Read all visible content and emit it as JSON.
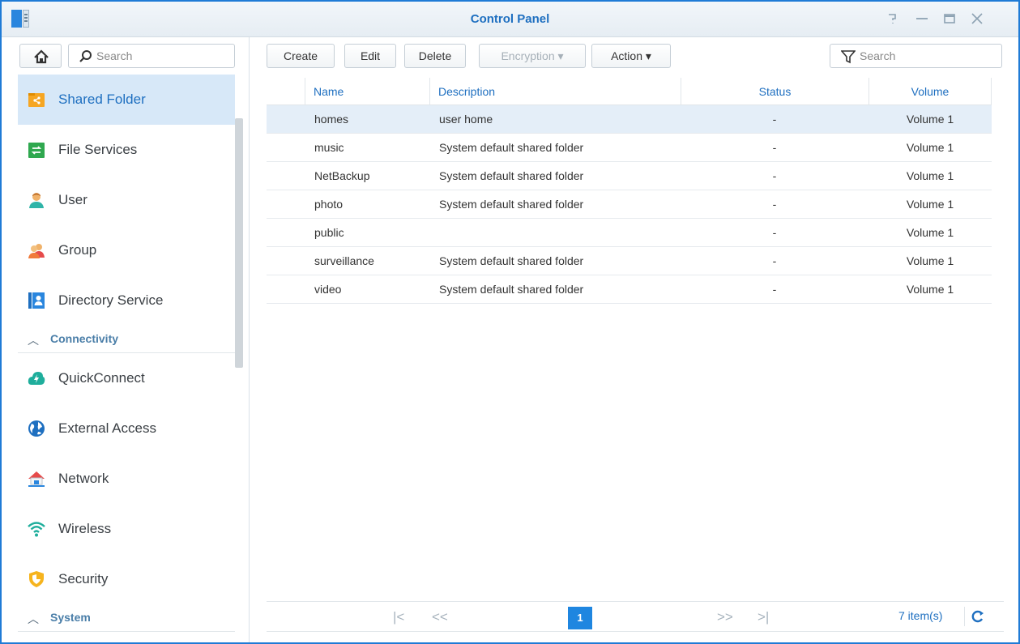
{
  "window": {
    "title": "Control Panel"
  },
  "sidebar": {
    "search_placeholder": "Search",
    "items": [
      {
        "label": "Shared Folder",
        "icon": "shared-folder-icon",
        "active": true
      },
      {
        "label": "File Services",
        "icon": "file-services-icon"
      },
      {
        "label": "User",
        "icon": "user-icon"
      },
      {
        "label": "Group",
        "icon": "group-icon"
      },
      {
        "label": "Directory Service",
        "icon": "directory-service-icon"
      }
    ],
    "sections": [
      {
        "label": "Connectivity",
        "items": [
          {
            "label": "QuickConnect",
            "icon": "quickconnect-icon"
          },
          {
            "label": "External Access",
            "icon": "external-access-icon"
          },
          {
            "label": "Network",
            "icon": "network-icon"
          },
          {
            "label": "Wireless",
            "icon": "wireless-icon"
          },
          {
            "label": "Security",
            "icon": "security-icon"
          }
        ]
      },
      {
        "label": "System"
      }
    ]
  },
  "toolbar": {
    "create": "Create",
    "edit": "Edit",
    "delete": "Delete",
    "encryption": "Encryption ▾",
    "action": "Action ▾",
    "search_placeholder": "Search"
  },
  "table": {
    "columns": [
      "Name",
      "Description",
      "Status",
      "Volume"
    ],
    "rows": [
      {
        "name": "homes",
        "description": "user home",
        "status": "-",
        "volume": "Volume 1",
        "selected": true
      },
      {
        "name": "music",
        "description": "System default shared folder",
        "status": "-",
        "volume": "Volume 1"
      },
      {
        "name": "NetBackup",
        "description": "System default shared folder",
        "status": "-",
        "volume": "Volume 1"
      },
      {
        "name": "photo",
        "description": "System default shared folder",
        "status": "-",
        "volume": "Volume 1"
      },
      {
        "name": "public",
        "description": "",
        "status": "-",
        "volume": "Volume 1"
      },
      {
        "name": "surveillance",
        "description": "System default shared folder",
        "status": "-",
        "volume": "Volume 1"
      },
      {
        "name": "video",
        "description": "System default shared folder",
        "status": "-",
        "volume": "Volume 1"
      }
    ]
  },
  "pager": {
    "current_page": "1",
    "item_count": "7 item(s)"
  },
  "colors": {
    "accent": "#1e6fc0",
    "selection": "#d7e8f8",
    "page_button": "#1f86e0"
  }
}
